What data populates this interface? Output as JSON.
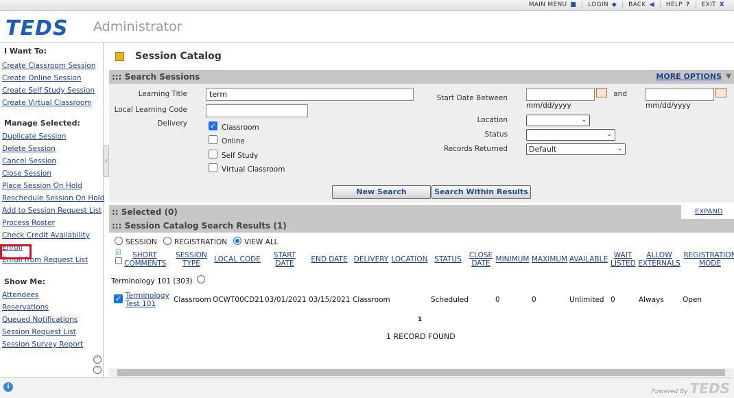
{
  "topnav": {
    "items": [
      {
        "label": "MAIN MENU",
        "icon": "■"
      },
      {
        "label": "LOGIN",
        "icon": "◆"
      },
      {
        "label": "BACK",
        "icon": "◀"
      },
      {
        "label": "HELP",
        "icon": "?"
      },
      {
        "label": "EXIT",
        "icon": "X"
      }
    ]
  },
  "header": {
    "logo": "TEDS",
    "subtitle": "Administrator"
  },
  "sidebar": {
    "i_want_to": "I Want To:",
    "want_links": [
      "Create Classroom Session",
      "Create Online Session",
      "Create Self Study Session",
      "Create Virtual Classroom"
    ],
    "manage_selected": "Manage Selected:",
    "manage_links": [
      "Duplicate Session",
      "Delete Session",
      "Cancel Session",
      "Close Session",
      "Place Session On Hold",
      "Reschedule Session On Hold",
      "Add to Session Request List",
      "Process Roster",
      "Check Credit Availability",
      "Enroll",
      "Enroll from Request List"
    ],
    "show_me": "Show Me:",
    "show_links": [
      "Attendees",
      "Reservations",
      "Queued Notifications",
      "Session Request List",
      "Session Survey Report"
    ]
  },
  "main": {
    "title": "Session Catalog",
    "search_bar": "::: Search Sessions",
    "more_options": "MORE OPTIONS",
    "search": {
      "learning_title_label": "Learning Title",
      "learning_title_value": "term",
      "local_code_label": "Local Learning Code",
      "local_code_value": "",
      "delivery_label": "Delivery",
      "delivery_options": [
        {
          "label": "Classroom",
          "checked": true
        },
        {
          "label": "Online",
          "checked": false
        },
        {
          "label": "Self Study",
          "checked": false
        },
        {
          "label": "Virtual Classroom",
          "checked": false
        }
      ],
      "start_date_label": "Start Date Between",
      "and_label": "and",
      "date_format_1": "mm/dd/yyyy",
      "date_format_2": "mm/dd/yyyy",
      "location_label": "Location",
      "location_value": "",
      "status_label": "Status",
      "status_value": "",
      "records_label": "Records Returned",
      "records_value": "Default",
      "new_search": "New Search",
      "search_within": "Search Within Results"
    },
    "selected_bar": ":: Selected (0)",
    "expand": "EXPAND",
    "results_bar": "::: Session Catalog Search Results (1)",
    "view_options": [
      {
        "label": "SESSION",
        "selected": false
      },
      {
        "label": "REGISTRATION",
        "selected": false
      },
      {
        "label": "VIEW ALL",
        "selected": true
      }
    ],
    "columns": [
      "SHORT COMMENTS",
      "SESSION TYPE",
      "LOCAL CODE",
      "START DATE",
      "END DATE",
      "DELIVERY",
      "LOCATION",
      "STATUS",
      "CLOSE DATE",
      "MINIMUM",
      "MAXIMUM",
      "AVAILABLE",
      "WAIT LISTED",
      "ALLOW EXTERNALS",
      "REGISTRATION MODE"
    ],
    "group_label": "Terminology 101 (303)",
    "row": {
      "title": "Terminology Test 101",
      "session_type": "Classroom",
      "local_code": "OCWT00CD21",
      "start_date": "03/01/2021",
      "end_date": "03/15/2021",
      "delivery": "Classroom",
      "status": "Scheduled",
      "minimum": "0",
      "maximum": "0",
      "available": "Unlimited",
      "wait_listed": "0",
      "allow_externals": "Always",
      "registration_mode": "Open"
    },
    "page_number": "1",
    "record_count": "1  RECORD FOUND"
  },
  "footer": {
    "powered_by": "Powered By",
    "logo": "TEDS"
  },
  "colors": {
    "link": "#1f3f8f",
    "bar": "#c6c6c6",
    "logo": "#1d5db5",
    "highlight": "#d2142a"
  }
}
